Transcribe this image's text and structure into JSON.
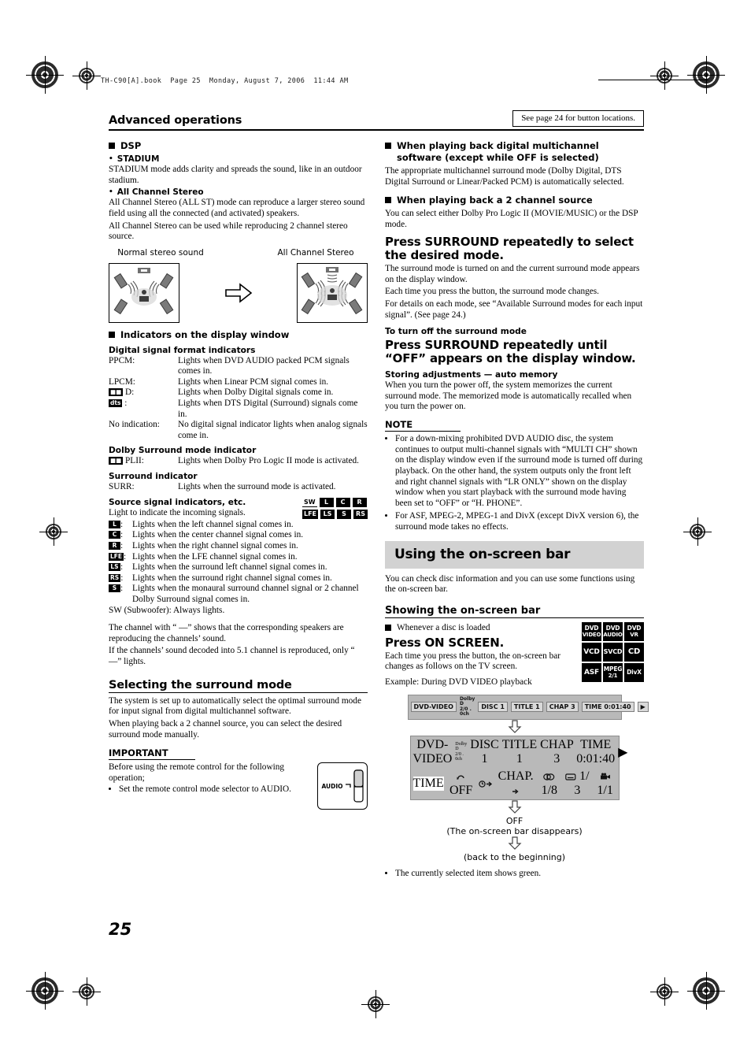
{
  "running_head": "TH-C90[A].book  Page 25  Monday, August 7, 2006  11:44 AM",
  "page_number": "25",
  "header": {
    "title": "Advanced operations",
    "see_page_note": "See page 24 for button locations."
  },
  "left_column": {
    "dsp": {
      "heading": "DSP",
      "stadium_label": "STADIUM",
      "stadium_text": "STADIUM mode adds clarity and spreads the sound, like in an outdoor stadium.",
      "all_channel_label": "All Channel Stereo",
      "all_channel_text_1": "All Channel Stereo (ALL ST) mode can reproduce a larger stereo sound field using all the connected (and activated) speakers.",
      "all_channel_text_2": "All Channel Stereo can be used while reproducing 2 channel stereo source."
    },
    "diagram": {
      "left_label": "Normal stereo sound",
      "right_label": "All Channel Stereo"
    },
    "indicators": {
      "heading": "Indicators on the display window",
      "digital_heading": "Digital signal format indicators",
      "digital_rows": [
        {
          "term": "PPCM:",
          "desc": "Lights when DVD AUDIO packed PCM signals comes in."
        },
        {
          "term": "▉▉ D:",
          "desc": "Lights when Dolby Digital signals come in."
        },
        {
          "term": "LPCM:",
          "desc": "Lights when Linear PCM signal comes in."
        },
        {
          "term": "dts:",
          "desc": "Lights when DTS Digital (Surround) signals come in."
        },
        {
          "term": "No indication:",
          "desc": "No digital signal indicator lights when analog signals come in."
        }
      ],
      "dolby_heading": "Dolby Surround mode indicator",
      "dolby_term": "PLII:",
      "dolby_desc": "Lights when Dolby Pro Logic II mode is activated.",
      "surround_heading": "Surround indicator",
      "surround_term": "SURR:",
      "surround_desc": "Lights when the surround mode is activated.",
      "source_heading": "Source signal indicators, etc.",
      "source_intro": "Light to indicate the incoming signals.",
      "channel_rows": [
        {
          "key": "L",
          "text": "Lights when the left channel signal comes in."
        },
        {
          "key": "C",
          "text": "Lights when the center channel signal comes in."
        },
        {
          "key": "R",
          "text": "Lights when the right channel signal comes in."
        },
        {
          "key": "LFE",
          "text": "Lights when the LFE channel signal comes in."
        },
        {
          "key": "LS",
          "text": "Lights when the surround left channel signal comes in."
        },
        {
          "key": "RS",
          "text": "Lights when the surround right channel signal comes in."
        },
        {
          "key": "S",
          "text": "Lights when the monaural surround channel signal or 2 channel Dolby Surround signal comes in."
        }
      ],
      "subwoofer_line": "SW (Subwoofer): Always lights.",
      "grid_row1": [
        "SW",
        "L",
        "C",
        "R"
      ],
      "grid_row2": [
        "LFE",
        "LS",
        "S",
        "RS"
      ],
      "note_1": "The channel with “ —” shows that the corresponding speakers are reproducing the channels’ sound.",
      "note_2": "If the channels’ sound decoded into 5.1 channel is reproduced, only “ —” lights."
    },
    "selecting": {
      "heading": "Selecting the surround mode",
      "text_1": "The system is set up to automatically select the optimal surround mode for input signal from digital multichannel software.",
      "text_2": "When playing back a 2 channel source, you can select the desired surround mode manually.",
      "important_label": "IMPORTANT",
      "important_text": "Before using the remote control for the following operation;",
      "important_bullet": "Set the remote control mode selector to AUDIO.",
      "remote_label": "AUDIO"
    }
  },
  "right_column": {
    "multichannel": {
      "heading": "When playing back digital multichannel software (except while OFF is selected)",
      "text": "The appropriate multichannel surround mode (Dolby Digital, DTS Digital Surround or Linear/Packed PCM) is automatically selected."
    },
    "two_channel": {
      "heading": "When playing back a 2 channel source",
      "text": "You can select either Dolby Pro Logic II (MOVIE/MUSIC) or the DSP mode."
    },
    "press_surround": {
      "instruction": "Press SURROUND repeatedly to select the desired mode.",
      "text_1": "The surround mode is turned on and the current surround mode appears on the display window.",
      "text_2": "Each time you press the button, the surround mode changes.",
      "text_3": "For details on each mode, see “Available Surround modes for each input signal”. (See page 24.)"
    },
    "turn_off": {
      "label": "To turn off the surround mode",
      "instruction": "Press SURROUND repeatedly until “OFF” appears on the display window."
    },
    "storing": {
      "heading": "Storing adjustments — auto memory",
      "text": "When you turn the power off, the system memorizes the current surround mode. The memorized mode is automatically recalled when you turn the power on."
    },
    "note": {
      "label": "NOTE",
      "items": [
        "For a down-mixing prohibited DVD AUDIO disc, the system continues to output multi-channel signals with “MULTI CH” shown on the display window even if the surround mode is turned off during playback. On the other hand, the system outputs only the front left and right channel signals with “LR ONLY” shown on the display window when you start playback with the surround mode having been set to “OFF” or “H. PHONE”.",
        "For ASF, MPEG-2, MPEG-1 and DivX (except DivX version 6), the surround mode takes no effects."
      ]
    },
    "onscreen": {
      "banner": "Using the on-screen bar",
      "intro": "You can check disc information and you can use some functions using the on-screen bar.",
      "section_heading": "Showing the on-screen bar",
      "whenever": "Whenever a disc is loaded",
      "press": "Press ON SCREEN.",
      "press_text": "Each time you press the button, the on-screen bar changes as follows on the TV screen.",
      "example_label": "Example: During DVD VIDEO playback",
      "disc_badges": [
        {
          "l1": "DVD",
          "l2": "VIDEO"
        },
        {
          "l1": "DVD",
          "l2": "AUDIO"
        },
        {
          "l1": "DVD",
          "l2": "VR"
        },
        {
          "l1": "VCD",
          "l2": ""
        },
        {
          "l1": "SVCD",
          "l2": ""
        },
        {
          "l1": "CD",
          "l2": ""
        },
        {
          "l1": "ASF",
          "l2": ""
        },
        {
          "l1": "MPEG",
          "l2": "2/1"
        },
        {
          "l1": "DivX",
          "l2": ""
        }
      ],
      "bar_row1": {
        "disc_type": "DVD-VIDEO",
        "audio_format_l1": "Dolby D",
        "audio_format_l2": "2/0 . 0ch",
        "cells": [
          "DISC 1",
          "TITLE 1",
          "CHAP 3",
          "TIME   0:01:40"
        ],
        "next_arrow": "▶"
      },
      "bar_row2": {
        "time_label": "TIME",
        "repeat": "OFF",
        "chap_label": "CHAP.",
        "audio": "1/8",
        "subtitle": "1/ 3",
        "angle": "1/1"
      },
      "flow_off": "OFF",
      "flow_off_note": "(The on-screen bar disappears)",
      "flow_back": "(back to the beginning)",
      "final_note": "The currently selected item shows green."
    }
  }
}
